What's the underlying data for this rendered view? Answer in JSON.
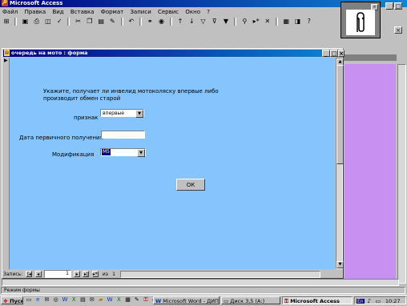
{
  "app": {
    "title": "Microsoft Access",
    "title_buttons": [
      "_",
      "□",
      "×"
    ]
  },
  "menu": [
    "Файл",
    "Правка",
    "Вид",
    "Вставка",
    "Формат",
    "Записи",
    "Сервис",
    "Окно",
    "?"
  ],
  "toolbar_icons": [
    "view-icon",
    "save-icon",
    "print-icon",
    "preview-icon",
    "spell-icon",
    "cut-icon",
    "copy-icon",
    "paste-icon",
    "format-painter-icon",
    "undo-icon",
    "hyperlink-icon",
    "web-icon",
    "sort-asc-icon",
    "sort-desc-icon",
    "filter-selection-icon",
    "filter-form-icon",
    "apply-filter-icon",
    "find-icon",
    "new-record-icon",
    "delete-record-icon",
    "database-window-icon",
    "new-object-icon",
    "help-icon"
  ],
  "form_window": {
    "title": "очередь на мото : форма",
    "buttons": [
      "_",
      "□",
      "×"
    ]
  },
  "form": {
    "instruction": "Укажите, получает ли инвелид мотоколяску впервые либо производит обмен старой",
    "priznak_label": "признак",
    "priznak_value": "впервые",
    "date_label": "Дата первичного получения",
    "date_value": "",
    "mod_label": "Модификация",
    "mod_value": "М5",
    "ok_button": "ОК"
  },
  "record_nav": {
    "label": "Запись:",
    "current": "1",
    "of_label": "из",
    "total": "1"
  },
  "status_bar": {
    "text": "Режим формы"
  },
  "taskbar": {
    "start": "Пуск",
    "tasks": [
      "Microsoft Word - ДИПЛО...",
      "Диск 3,5 (A:)",
      "Microsoft Access"
    ],
    "tray_lang": "En",
    "clock": "10:27"
  },
  "colors": {
    "form_background": "#85c4fc",
    "side_panel": "#c890f0",
    "title_bar": "#000080"
  }
}
